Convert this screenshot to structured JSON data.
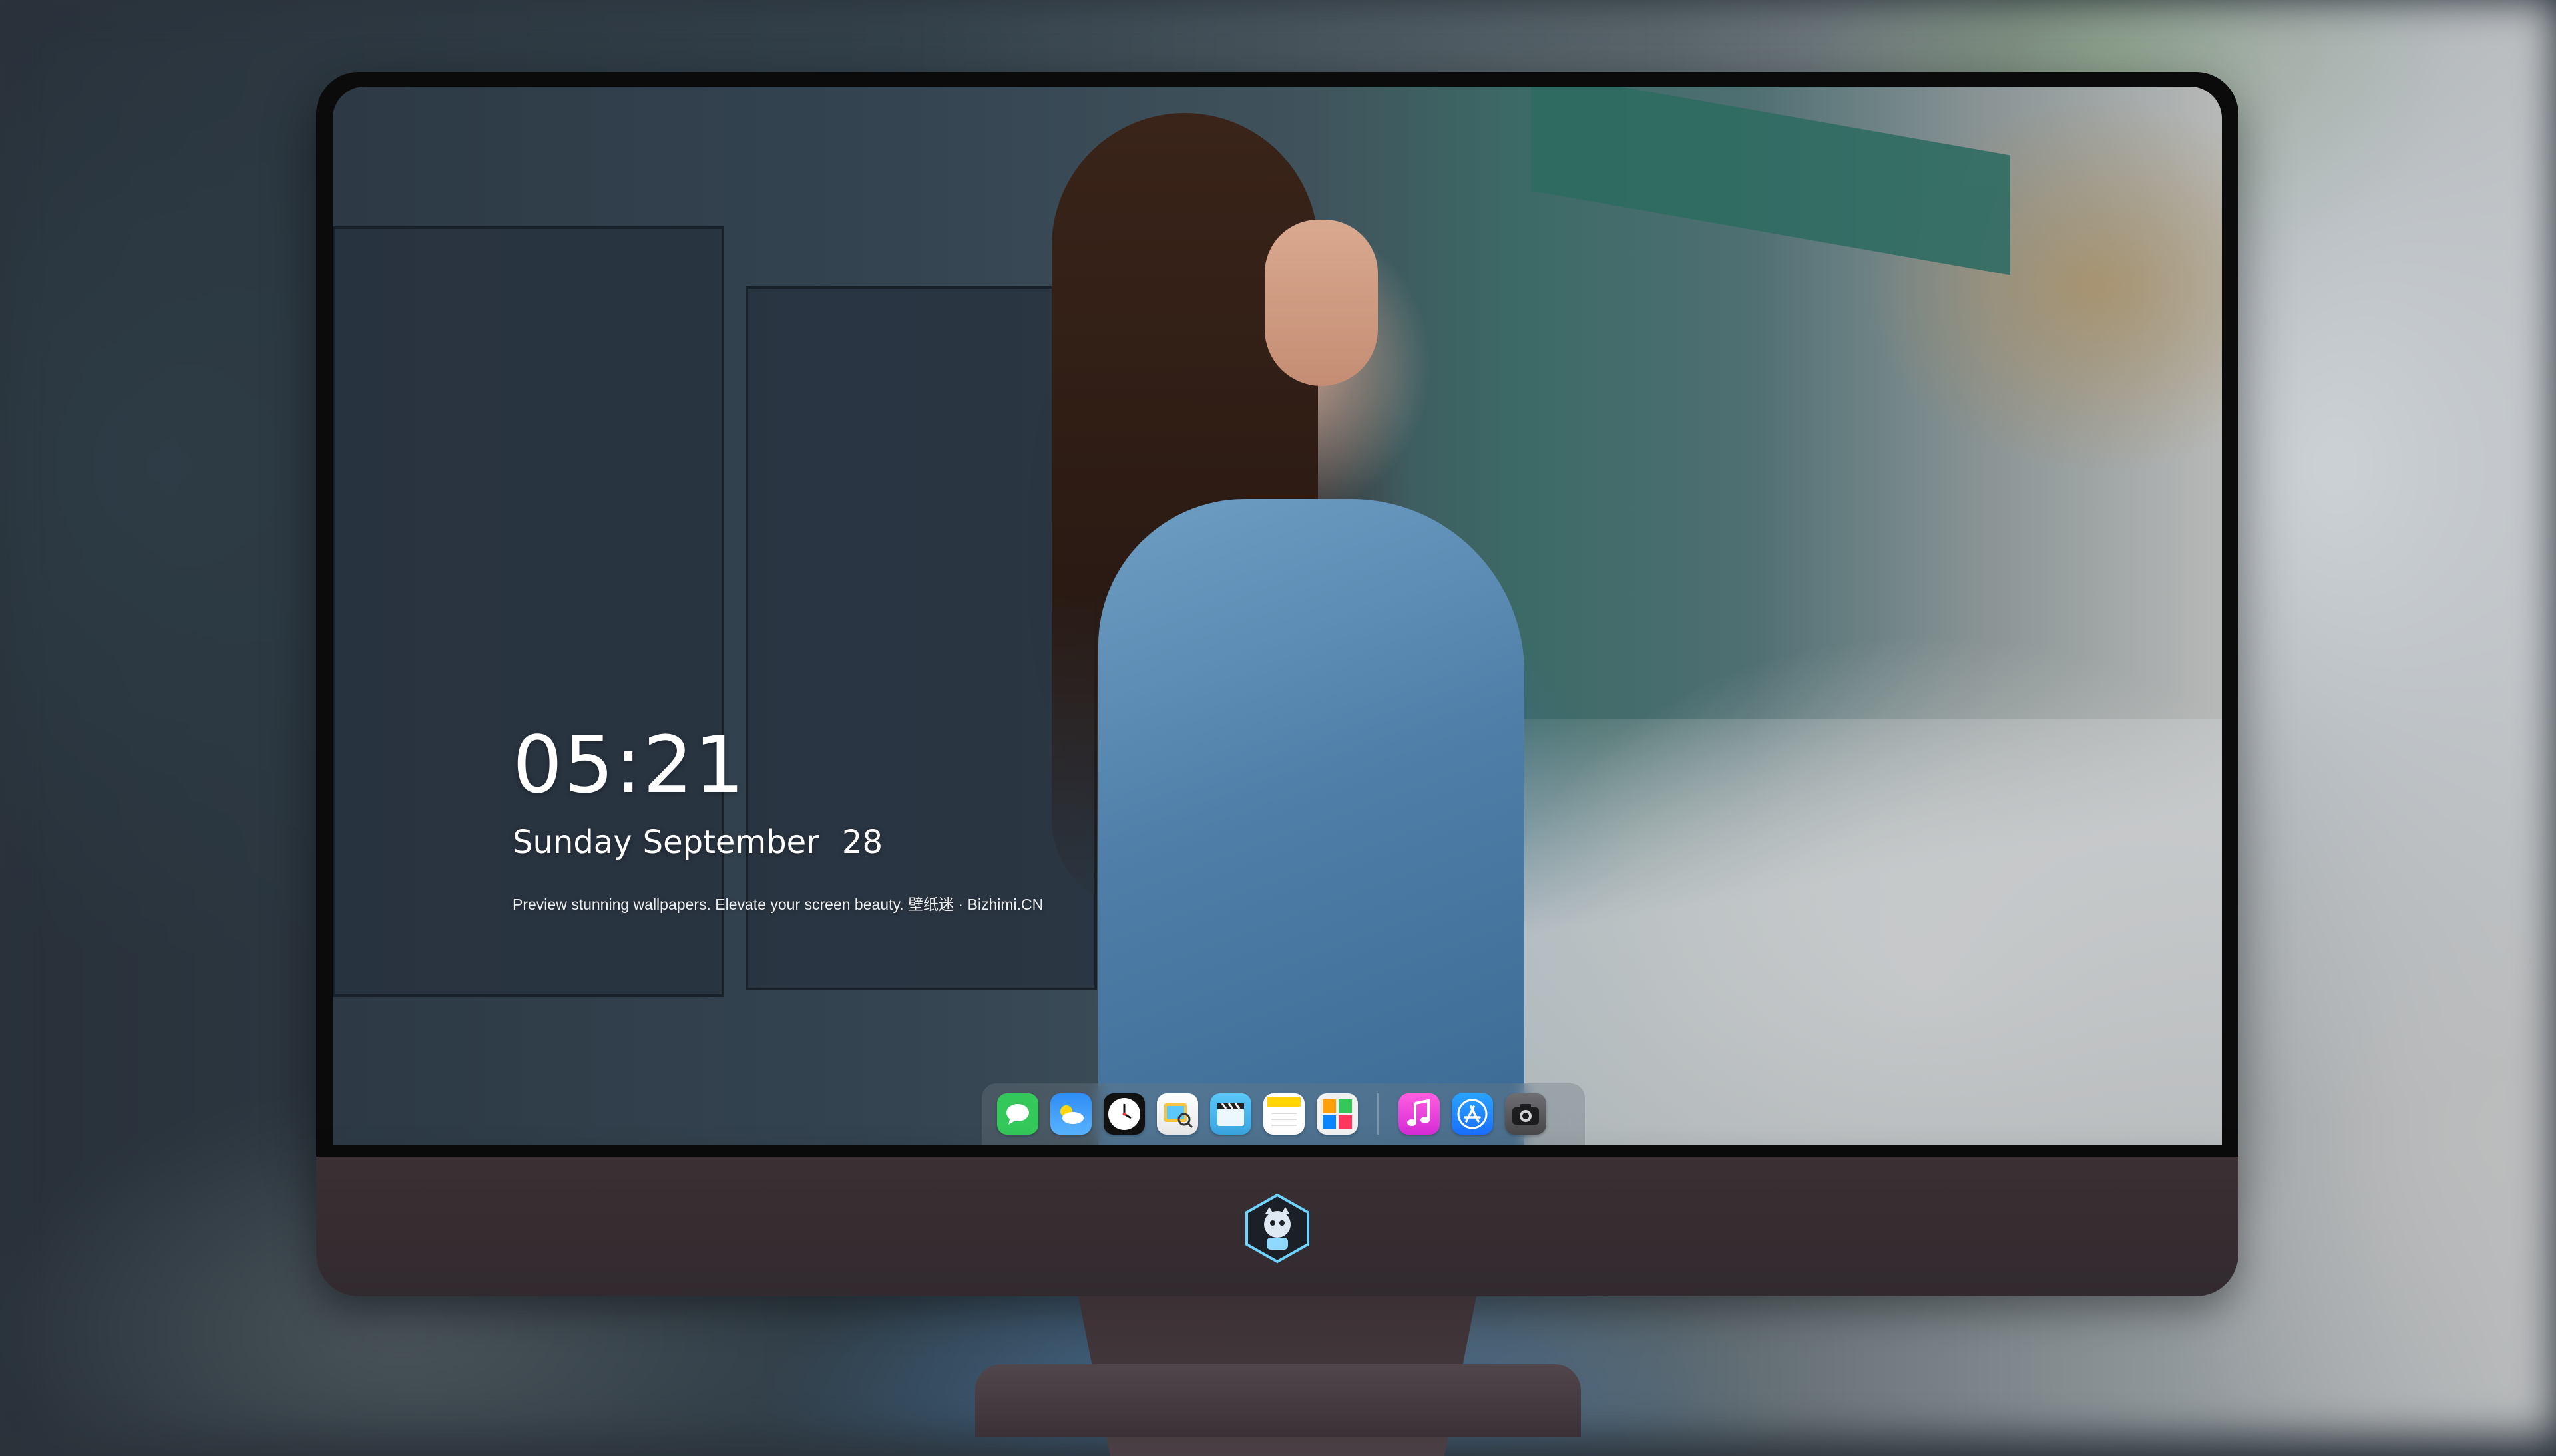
{
  "lockscreen": {
    "time": "05:21",
    "day": "Sunday",
    "month": "September",
    "date": "28",
    "tagline": "Preview stunning wallpapers. Elevate your screen beauty. 壁纸迷 · Bizhimi.CN"
  },
  "dock": {
    "apps": [
      {
        "name": "messages-icon",
        "color": "#34c759"
      },
      {
        "name": "weather-icon",
        "color": "#2f8df5"
      },
      {
        "name": "clock-icon",
        "color": "#ffffff"
      },
      {
        "name": "preview-icon",
        "color": "#f5c542"
      },
      {
        "name": "clips-icon",
        "color": "#5ac8fa"
      },
      {
        "name": "notes-icon",
        "color": "#ffd60a"
      },
      {
        "name": "photo-collage-icon",
        "color": "#eaeaea"
      },
      {
        "name": "music-icon",
        "color": "#ff3bd5"
      },
      {
        "name": "app-store-icon",
        "color": "#1a8cff"
      },
      {
        "name": "camera-icon",
        "color": "#5b5b5f"
      }
    ]
  },
  "colors": {
    "bezel": "#0b0b0c",
    "chin": "#3b3034",
    "text": "#ffffff"
  }
}
